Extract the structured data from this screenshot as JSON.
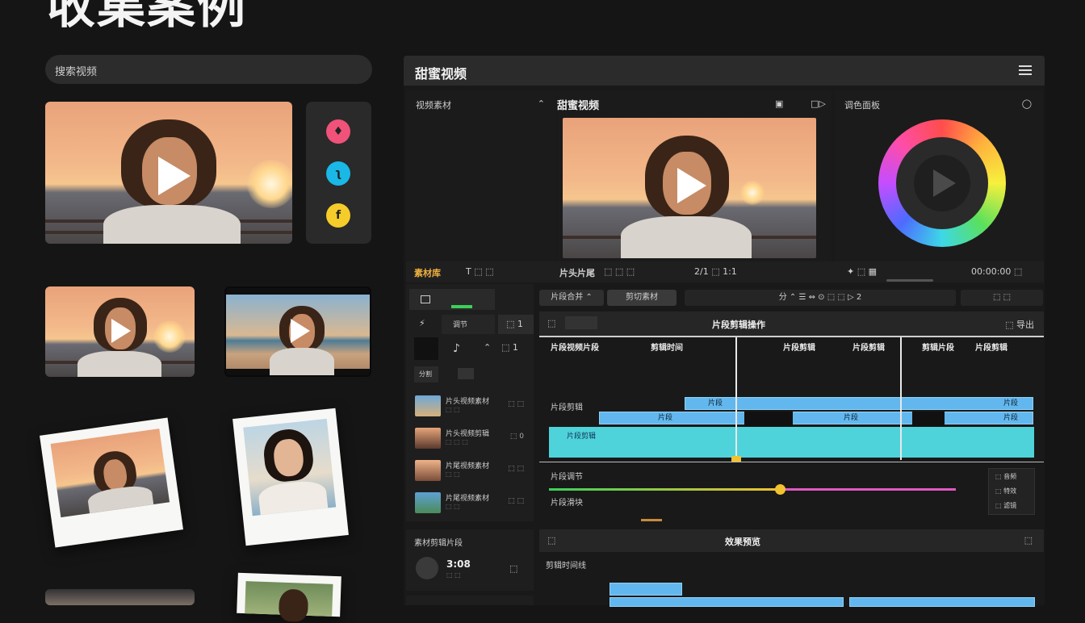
{
  "page": {
    "title": "收集案例"
  },
  "search": {
    "placeholder": "搜索视频"
  },
  "social": {
    "icons": [
      "instagram-icon",
      "twitter-icon",
      "facebook-icon"
    ],
    "glyphs": [
      "♦",
      "ʅ",
      "f"
    ]
  },
  "editor": {
    "title": "甜蜜视频",
    "left_panel": {
      "label": "视频素材",
      "arrow": "⌃"
    },
    "preview": {
      "title": "甜蜜视频",
      "icons": [
        "▣",
        "□▷"
      ]
    },
    "right_panel": {
      "label": "调色面板",
      "search_glyph": "◯"
    },
    "transport": {
      "left_label": "✦ ⬚ ▦",
      "center_label": "2/1 ⬚ 1:1",
      "timecode": "00:00:00 ⬚"
    },
    "left_tabs": {
      "active": "素材库",
      "tools": "T  ⬚  ⬚"
    },
    "preview_tabs": {
      "label": "片头片尾",
      "glyph": "⬚ ⬚ ⬚"
    },
    "toolbar_buttons": [
      "片段合并 ⌃",
      "剪切素材",
      "分 ⌃  ☰  ⇔  ⊙  ⬚  ⬚  ▷ 2",
      "⬚ ⬚"
    ],
    "tool_grid": {
      "labels": [
        "⚡",
        "调节",
        "♪",
        "⌃",
        "⬚  1"
      ],
      "row3": [
        "分割",
        "⬚"
      ]
    },
    "timeline_header": {
      "left_btn": "⬚",
      "center": "片段剪辑操作",
      "right": "⬚ 导出"
    },
    "ruler_labels": [
      "片段视频片段",
      "剪辑时间",
      "片段剪辑",
      "片段剪辑",
      "剪辑片段",
      "片段剪辑"
    ],
    "tracks": {
      "label_main": "片段剪辑",
      "clips_row1": [
        "片段",
        "片段"
      ],
      "clips_row2": [
        "片段",
        "片段",
        "片段"
      ],
      "teal_label": "片段剪辑"
    },
    "audio": {
      "label": "片段调节",
      "label2": "片段滑块",
      "side": [
        "⬚ 音频",
        "⬚ 特效",
        "⬚ 滤镜"
      ],
      "level": 0.57
    },
    "media_list": [
      {
        "title": "片头视频素材",
        "sub": "⬚ ⬚",
        "icon": "⬚ ⬚"
      },
      {
        "title": "片头视频剪辑",
        "sub": "⬚ ⬚ ⬚",
        "icon": "⬚ 0"
      },
      {
        "title": "片尾视频素材",
        "sub": "⬚ ⬚",
        "icon": "⬚ ⬚"
      },
      {
        "title": "片尾视频素材",
        "sub": "⬚ ⬚",
        "icon": "⬚ ⬚"
      }
    ],
    "bottom_left": {
      "label": "素材剪辑片段",
      "time": "3:08",
      "sub": "⬚ ⬚",
      "icon": "⬚"
    },
    "bottom_bar": {
      "left": "⬚",
      "center": "效果预览",
      "right": "⬚"
    },
    "bottom_track_label": "剪辑时间线"
  },
  "colors": {
    "accent_teal": "#4fd3da",
    "clip_blue": "#62b8ee",
    "slider_yellow": "#f2c230",
    "slider_pink": "#e05ac0"
  }
}
